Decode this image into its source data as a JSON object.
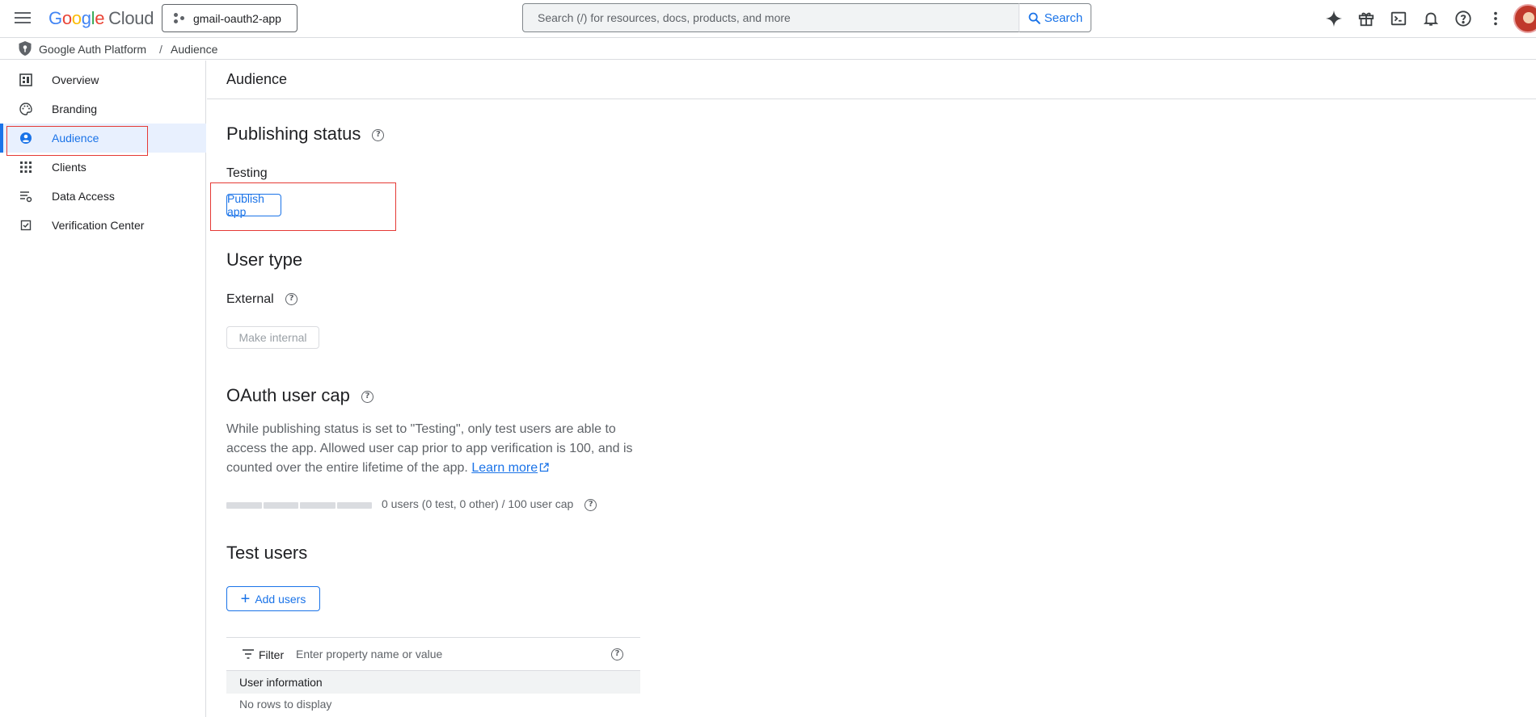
{
  "header": {
    "logo_letters": [
      "G",
      "o",
      "o",
      "g",
      "l",
      "e"
    ],
    "logo_suffix": "Cloud",
    "project_name": "gmail-oauth2-app",
    "search_placeholder": "Search (/) for resources, docs, products, and more",
    "search_button": "Search",
    "icons": [
      "gemini-icon",
      "gift-icon",
      "cloud-shell-icon",
      "notifications-icon",
      "help-icon",
      "more-vert-icon"
    ]
  },
  "breadcrumb": {
    "root": "Google Auth Platform",
    "separator": "/",
    "current": "Audience"
  },
  "sidebar": {
    "items": [
      {
        "label": "Overview",
        "icon": "dashboard-icon"
      },
      {
        "label": "Branding",
        "icon": "palette-icon"
      },
      {
        "label": "Audience",
        "icon": "person-circle-icon",
        "active": true
      },
      {
        "label": "Clients",
        "icon": "apps-grid-icon"
      },
      {
        "label": "Data Access",
        "icon": "data-settings-icon"
      },
      {
        "label": "Verification Center",
        "icon": "verified-checkbox-icon"
      }
    ]
  },
  "main": {
    "title": "Audience",
    "publishing": {
      "heading": "Publishing status",
      "status": "Testing",
      "button": "Publish app"
    },
    "user_type": {
      "heading": "User type",
      "value": "External",
      "button": "Make internal"
    },
    "oauth_cap": {
      "heading": "OAuth user cap",
      "description": "While publishing status is set to \"Testing\", only test users are able to access the app. Allowed user cap prior to app verification is 100, and is counted over the entire lifetime of the app.",
      "link": "Learn more",
      "progress_fraction": 0,
      "progress_text": "0 users (0 test, 0 other) / 100 user cap"
    },
    "test_users": {
      "heading": "Test users",
      "add_button": "Add users",
      "filter_label": "Filter",
      "filter_placeholder": "Enter property name or value",
      "column": "User information",
      "empty": "No rows to display"
    }
  },
  "colors": {
    "accent": "#1a73e8",
    "active_bg": "#e8f0fe",
    "highlight_box": "#e53935"
  }
}
